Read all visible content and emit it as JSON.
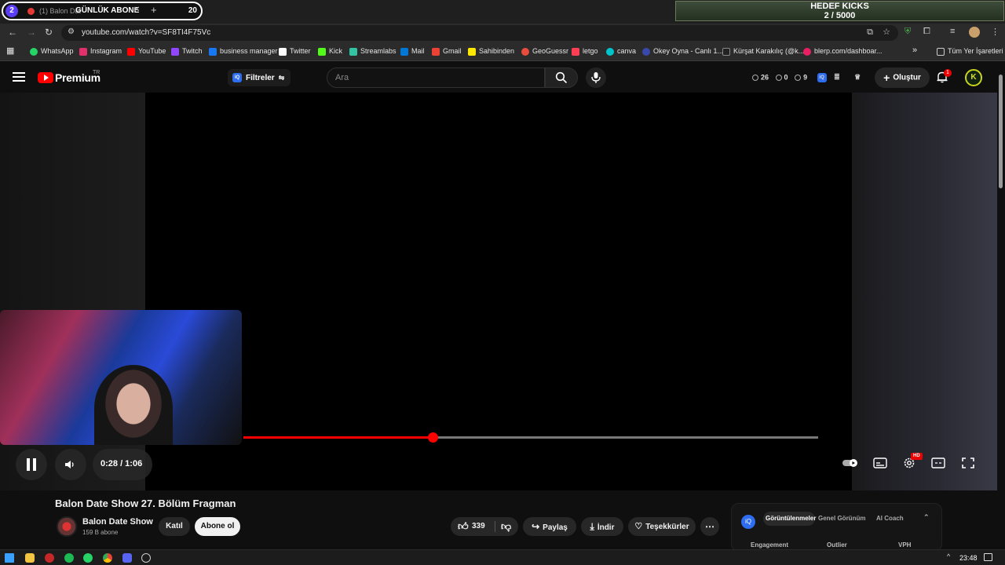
{
  "browser": {
    "tab_group_count": "2",
    "tab_title": "(1) Balon Dat",
    "tab_overlay": "GÜNLÜK ABONE",
    "tab_overlay_value": "20",
    "goal_title": "HEDEF KICKS",
    "goal_value": "2 / 5000",
    "url": "youtube.com/watch?v=SF8TI4F75Vc"
  },
  "bookmarks": [
    {
      "label": "WhatsApp",
      "color": "#25d366"
    },
    {
      "label": "Instagram",
      "color": "#e1306c"
    },
    {
      "label": "YouTube",
      "color": "#ff0000"
    },
    {
      "label": "Twitch",
      "color": "#9146ff"
    },
    {
      "label": "business manager",
      "color": "#1877f2"
    },
    {
      "label": "Twitter",
      "color": "#ffffff"
    },
    {
      "label": "Kick",
      "color": "#53fc18"
    },
    {
      "label": "Streamlabs",
      "color": "#31c3a2"
    },
    {
      "label": "Mail",
      "color": "#0078d4"
    },
    {
      "label": "Gmail",
      "color": "#ea4335"
    },
    {
      "label": "Sahibinden",
      "color": "#ffe800"
    },
    {
      "label": "GeoGuessr",
      "color": "#e74c3c"
    },
    {
      "label": "letgo",
      "color": "#ff3f55"
    },
    {
      "label": "canva",
      "color": "#00c4cc"
    },
    {
      "label": "Okey Oyna - Canlı 1...",
      "color": "#3949ab"
    },
    {
      "label": "Kürşat Karakılıç (@k...",
      "color": "#222222"
    },
    {
      "label": "blerp.com/dashboar...",
      "color": "#e91e63"
    }
  ],
  "bookmarks_all": "Tüm Yer İşaretleri",
  "yt": {
    "brand": "Premium",
    "region": "TR",
    "filter_label": "Filtreler",
    "search_placeholder": "Ara",
    "stat_1": "26",
    "stat_2": "0",
    "stat_3": "9",
    "create_label": "Oluştur",
    "notif_count": "1",
    "avatar_letter": "K"
  },
  "player": {
    "current_time": "0:28",
    "duration": "1:06",
    "time_display": "0:28 / 1:06",
    "progress_fraction": 0.3288,
    "quality_badge": "HD"
  },
  "video": {
    "title": "Balon Date Show 27. Bölüm Fragman",
    "channel_name": "Balon Date Show",
    "subscribers": "159 B abone",
    "join_label": "Katıl",
    "subscribe_label": "Abone ol",
    "likes": "339",
    "share_label": "Paylaş",
    "download_label": "İndir",
    "thanks_label": "Teşekkürler"
  },
  "panel": {
    "tab_active": "Görüntülenmeler",
    "tab_2": "Genel Görünüm",
    "tab_3": "AI Coach",
    "col_1": "Engagement",
    "col_2": "Outlier",
    "col_3": "VPH"
  },
  "taskbar": {
    "time": "23:48"
  }
}
